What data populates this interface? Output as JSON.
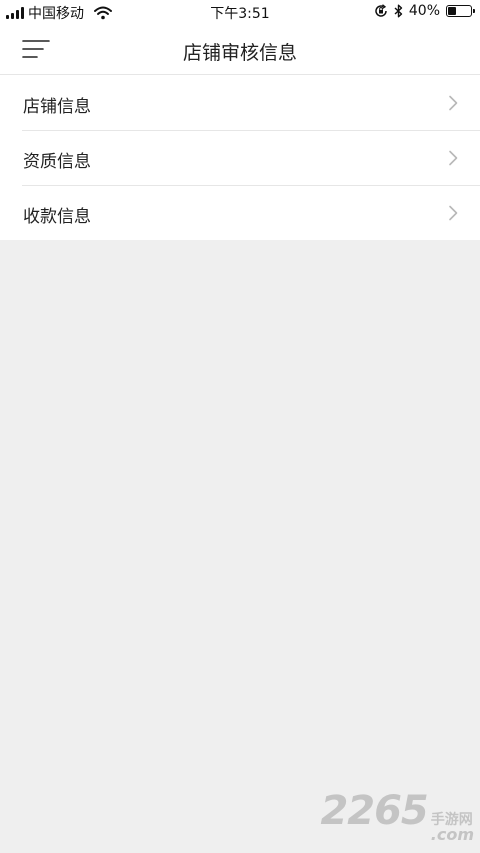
{
  "status_bar": {
    "carrier": "中国移动",
    "time": "下午3:51",
    "battery_percent": "40%",
    "battery_level": 0.4,
    "icons": [
      "signal-icon",
      "wifi-icon",
      "rotation-lock-icon",
      "bluetooth-icon",
      "battery-icon"
    ]
  },
  "nav": {
    "title": "店铺审核信息",
    "menu_icon": "menu-icon"
  },
  "list": {
    "items": [
      {
        "label": "店铺信息",
        "icon": "chevron-right-icon"
      },
      {
        "label": "资质信息",
        "icon": "chevron-right-icon"
      },
      {
        "label": "收款信息",
        "icon": "chevron-right-icon"
      }
    ]
  },
  "watermark": {
    "number": "2265",
    "cn": "手游网",
    "suffix": ".com"
  },
  "colors": {
    "background": "#efefef",
    "surface": "#ffffff",
    "divider": "#e6e6e6",
    "text": "#222222",
    "chevron": "#b8b8b8",
    "watermark": "#c4c4c4"
  }
}
